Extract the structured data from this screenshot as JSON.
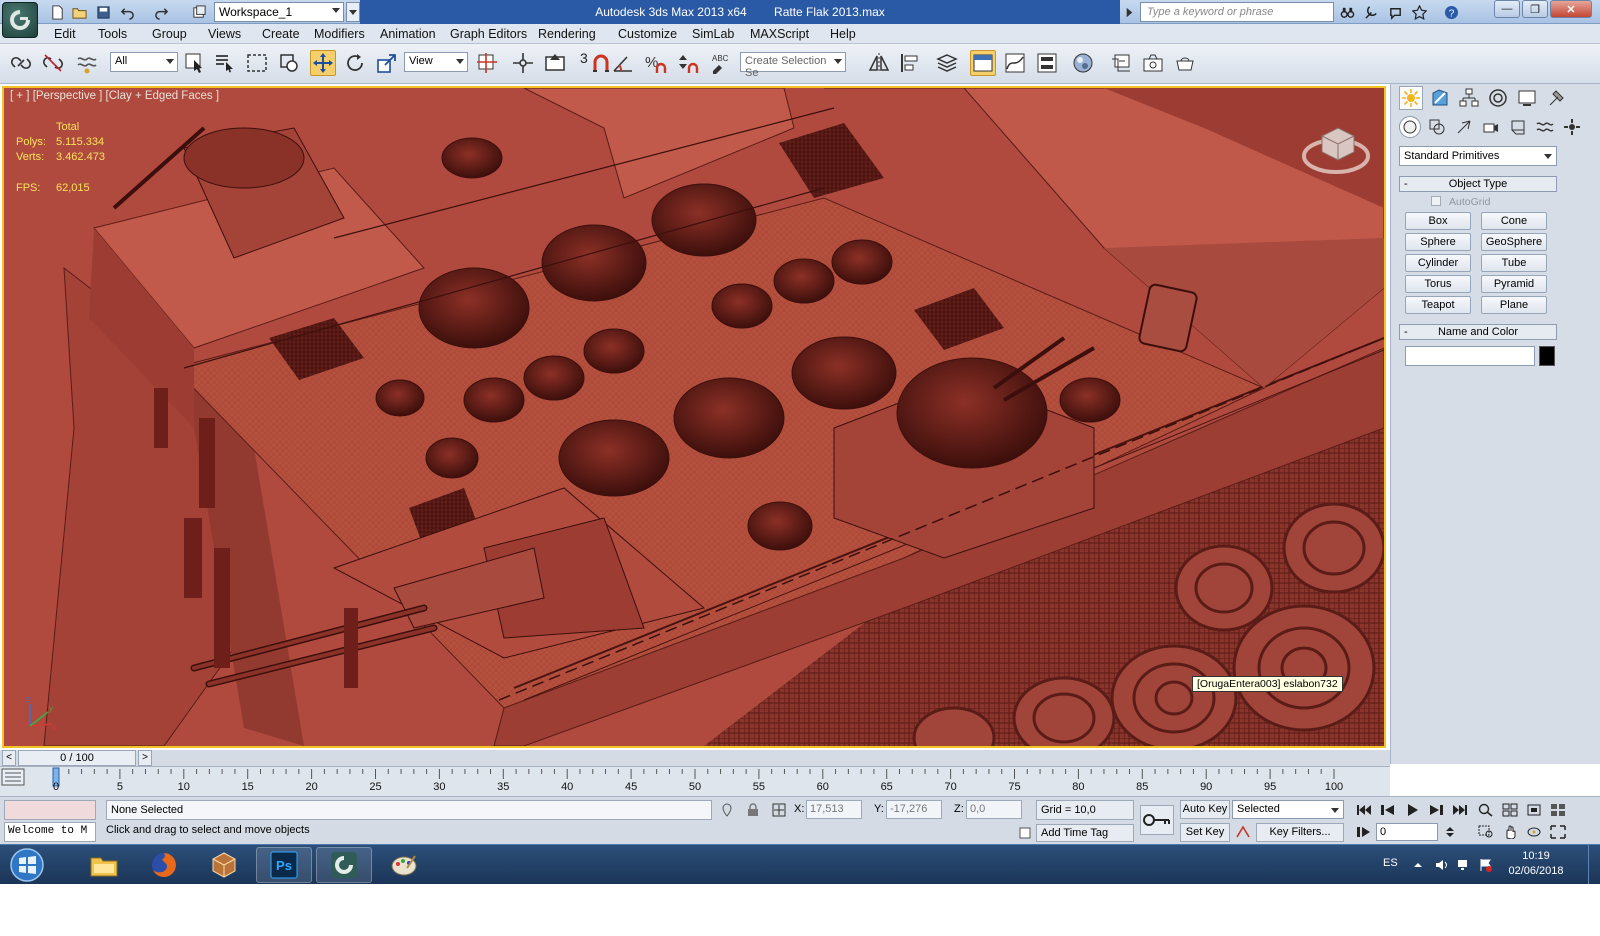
{
  "titlebar": {
    "workspace": "Workspace_1",
    "app_title": "Autodesk 3ds Max  2013 x64",
    "file_name": "Ratte Flak 2013.max",
    "search_placeholder": "Type a keyword or phrase"
  },
  "menu": [
    "Edit",
    "Tools",
    "Group",
    "Views",
    "Create",
    "Modifiers",
    "Animation",
    "Graph Editors",
    "Rendering",
    "Customize",
    "SimLab",
    "MAXScript",
    "Help"
  ],
  "toolbar": {
    "selection_filter": "All",
    "reference_coord": "View",
    "selection_set_placeholder": "Create Selection Se",
    "snap_label": "3",
    "icons": [
      "link-icon",
      "unlink-icon",
      "bind-spacewarp-icon",
      "select-object-icon",
      "select-by-name-icon",
      "rect-selection-region-icon",
      "window-crossing-icon",
      "select-move-icon",
      "select-rotate-icon",
      "select-scale-icon",
      "pivot-center-icon",
      "select-manipulate-icon",
      "snap-toggle-icon",
      "angle-snap-icon",
      "percent-snap-icon",
      "spinner-snap-icon",
      "edit-named-selection-icon",
      "mirror-icon",
      "align-icon",
      "layer-manager-icon",
      "graphite-ribbon-icon",
      "curve-editor-icon",
      "schematic-view-icon",
      "material-editor-icon",
      "render-setup-icon",
      "rendered-frame-window-icon",
      "render-production-icon"
    ]
  },
  "viewport": {
    "label": "[ + ] [Perspective ] [Clay + Edged Faces ]",
    "stats_header": "Total",
    "polys_label": "Polys:",
    "polys_value": "5.115.334",
    "verts_label": "Verts:",
    "verts_value": "3.462.473",
    "fps_label": "FPS:",
    "fps_value": "62,015",
    "tooltip": "[OrugaEntera003] eslabon732",
    "colors": {
      "clay": "#b04a3f",
      "clay_dark": "#6e1f19",
      "clay_light": "#c9675a",
      "border": "#f2c324",
      "stats": "#f7e35a"
    }
  },
  "command_panel": {
    "tabs": [
      "create-tab-icon",
      "modify-tab-icon",
      "hierarchy-tab-icon",
      "motion-tab-icon",
      "display-tab-icon",
      "utilities-tab-icon"
    ],
    "subtabs": [
      "geometry-icon",
      "shapes-icon",
      "lights-icon",
      "cameras-icon",
      "helpers-icon",
      "spacewarps-icon",
      "systems-icon"
    ],
    "primitives_dropdown": "Standard Primitives",
    "object_type_title": "Object Type",
    "autogrid": "AutoGrid",
    "buttons": [
      "Box",
      "Cone",
      "Sphere",
      "GeoSphere",
      "Cylinder",
      "Tube",
      "Torus",
      "Pyramid",
      "Teapot",
      "Plane"
    ],
    "name_color_title": "Name and Color",
    "name_value": "",
    "rollout_toggle": "-"
  },
  "timeline": {
    "frame_display": "0 / 100",
    "prev_arrow": "<",
    "next_arrow": ">",
    "ticks": [
      "0",
      "5",
      "10",
      "15",
      "20",
      "25",
      "30",
      "35",
      "40",
      "45",
      "50",
      "55",
      "60",
      "65",
      "70",
      "75",
      "80",
      "85",
      "90",
      "95",
      "100"
    ]
  },
  "status": {
    "welcome": "Welcome to M",
    "selection": "None Selected",
    "prompt": "Click and drag to select and move objects",
    "x_label": "X:",
    "x_value": "17,513",
    "y_label": "Y:",
    "y_value": "-17,276",
    "z_label": "Z:",
    "z_value": "0,0",
    "grid": "Grid = 10,0",
    "add_time_tag": "Add Time Tag",
    "auto_key": "Auto Key",
    "set_key": "Set Key",
    "selected_dropdown": "Selected",
    "key_filters": "Key Filters...",
    "current_frame": "0"
  },
  "taskbar": {
    "apps": [
      "windows-explorer-icon",
      "firefox-icon",
      "3dsmax-icon",
      "photoshop-icon",
      "3dsmax-2013-icon",
      "paint-icon"
    ],
    "language": "ES",
    "time": "10:19",
    "date": "02/06/2018"
  }
}
